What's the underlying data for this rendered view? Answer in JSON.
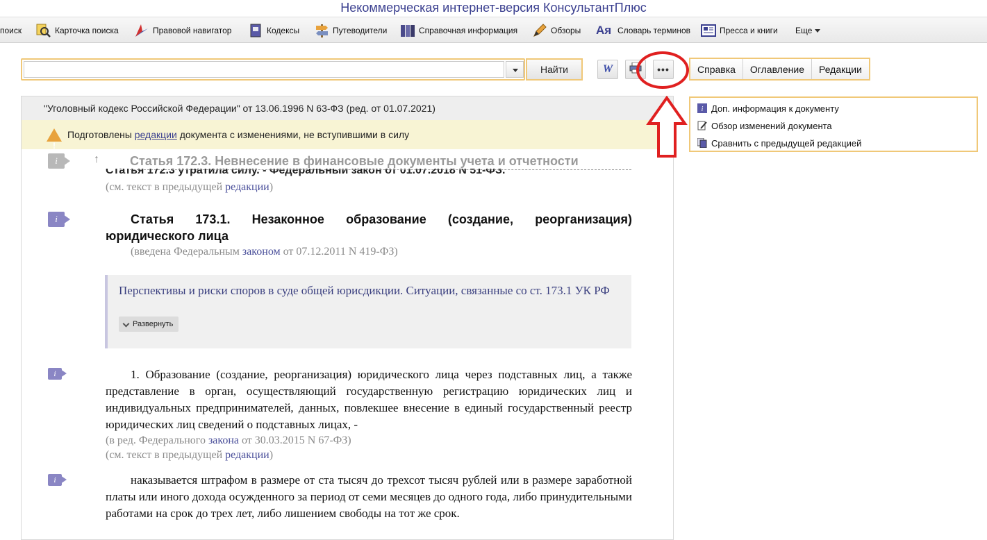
{
  "app": {
    "title": "Некоммерческая интернет-версия КонсультантПлюс"
  },
  "toolbar": {
    "items": [
      {
        "label": "поиск",
        "icon": "search-icon"
      },
      {
        "label": "Карточка поиска",
        "icon": "magnifier-card-icon"
      },
      {
        "label": "Правовой навигатор",
        "icon": "navigator-icon"
      },
      {
        "label": "Кодексы",
        "icon": "codex-book-icon"
      },
      {
        "label": "Путеводители",
        "icon": "signpost-icon"
      },
      {
        "label": "Справочная информация",
        "icon": "reference-books-icon"
      },
      {
        "label": "Обзоры",
        "icon": "pen-icon"
      },
      {
        "label": "Словарь терминов",
        "icon": "dictionary-icon"
      },
      {
        "label": "Пресса и книги",
        "icon": "newspaper-icon"
      },
      {
        "label": "Еще",
        "icon": "chevron-down-icon"
      }
    ]
  },
  "search": {
    "value": "",
    "placeholder": "",
    "button_label": "Найти"
  },
  "doc_tools": {
    "word_glyph": "W",
    "more_glyph": "•••"
  },
  "tabs": [
    "Справка",
    "Оглавление",
    "Редакции"
  ],
  "side_panel": {
    "items": [
      {
        "label": "Доп. информация к документу",
        "icon": "info-icon"
      },
      {
        "label": "Обзор изменений документа",
        "icon": "edit-doc-icon"
      },
      {
        "label": "Сравнить с предыдущей редакцией",
        "icon": "compare-docs-icon"
      }
    ]
  },
  "document": {
    "header": "\"Уголовный кодекс Российской Федерации\" от 13.06.1996 N 63-ФЗ (ред. от 01.07.2021)",
    "warning": {
      "before": "Подготовлены ",
      "link": "редакции",
      "after": " документа с изменениями, не вступившими в силу"
    },
    "sticky_title": "Статья 172.3. Невнесение в финансовые документы учета и отчетности",
    "ghost_line": "Статья 172.3 утратила силу. - Федеральный закон от 01.07.2018 N 51-ФЗ.",
    "see_prev_1": {
      "before": "(см. текст в предыдущей ",
      "link": "редакции",
      "after": ")"
    },
    "article_title": "Статья 173.1. Незаконное образование (создание, реорганизация) юридического лица",
    "introduced": {
      "before": "(введена Федеральным ",
      "link": "законом",
      "after": " от 07.12.2011 N 419-ФЗ)"
    },
    "commentary": {
      "text": "Перспективы и риски споров в суде общей юрисдикции. Ситуации, связанные со ст. 173.1 УК РФ",
      "expand_label": "Развернуть"
    },
    "paragraph_1": "1. Образование (создание, реорганизация) юридического лица через подставных лиц, а также представление в орган, осуществляющий государственную регистрацию юридических лиц и индивидуальных предпринимателей, данных, повлекшее внесение в единый государственный реестр юридических лиц сведений о подставных лицах, -",
    "amended": {
      "before": "(в ред. Федерального ",
      "link": "закона",
      "after": " от 30.03.2015 N 67-ФЗ)"
    },
    "see_prev_2": {
      "before": "(см. текст в предыдущей ",
      "link": "редакции",
      "after": ")"
    },
    "paragraph_2": "наказывается штрафом в размере от ста тысяч до трехсот тысяч рублей или в размере заработной платы или иного дохода осужденного за период от семи месяцев до одного года, либо принудительными работами на срок до трех лет, либо лишением свободы на тот же срок."
  },
  "annotation": {
    "circle_color": "#e02020",
    "arrow_color": "#e02020"
  },
  "colors": {
    "accent_border": "#f0c878",
    "link": "#3a3f8f",
    "info_mark": "#8a86c4",
    "warning_bg": "#f8f4d4"
  }
}
